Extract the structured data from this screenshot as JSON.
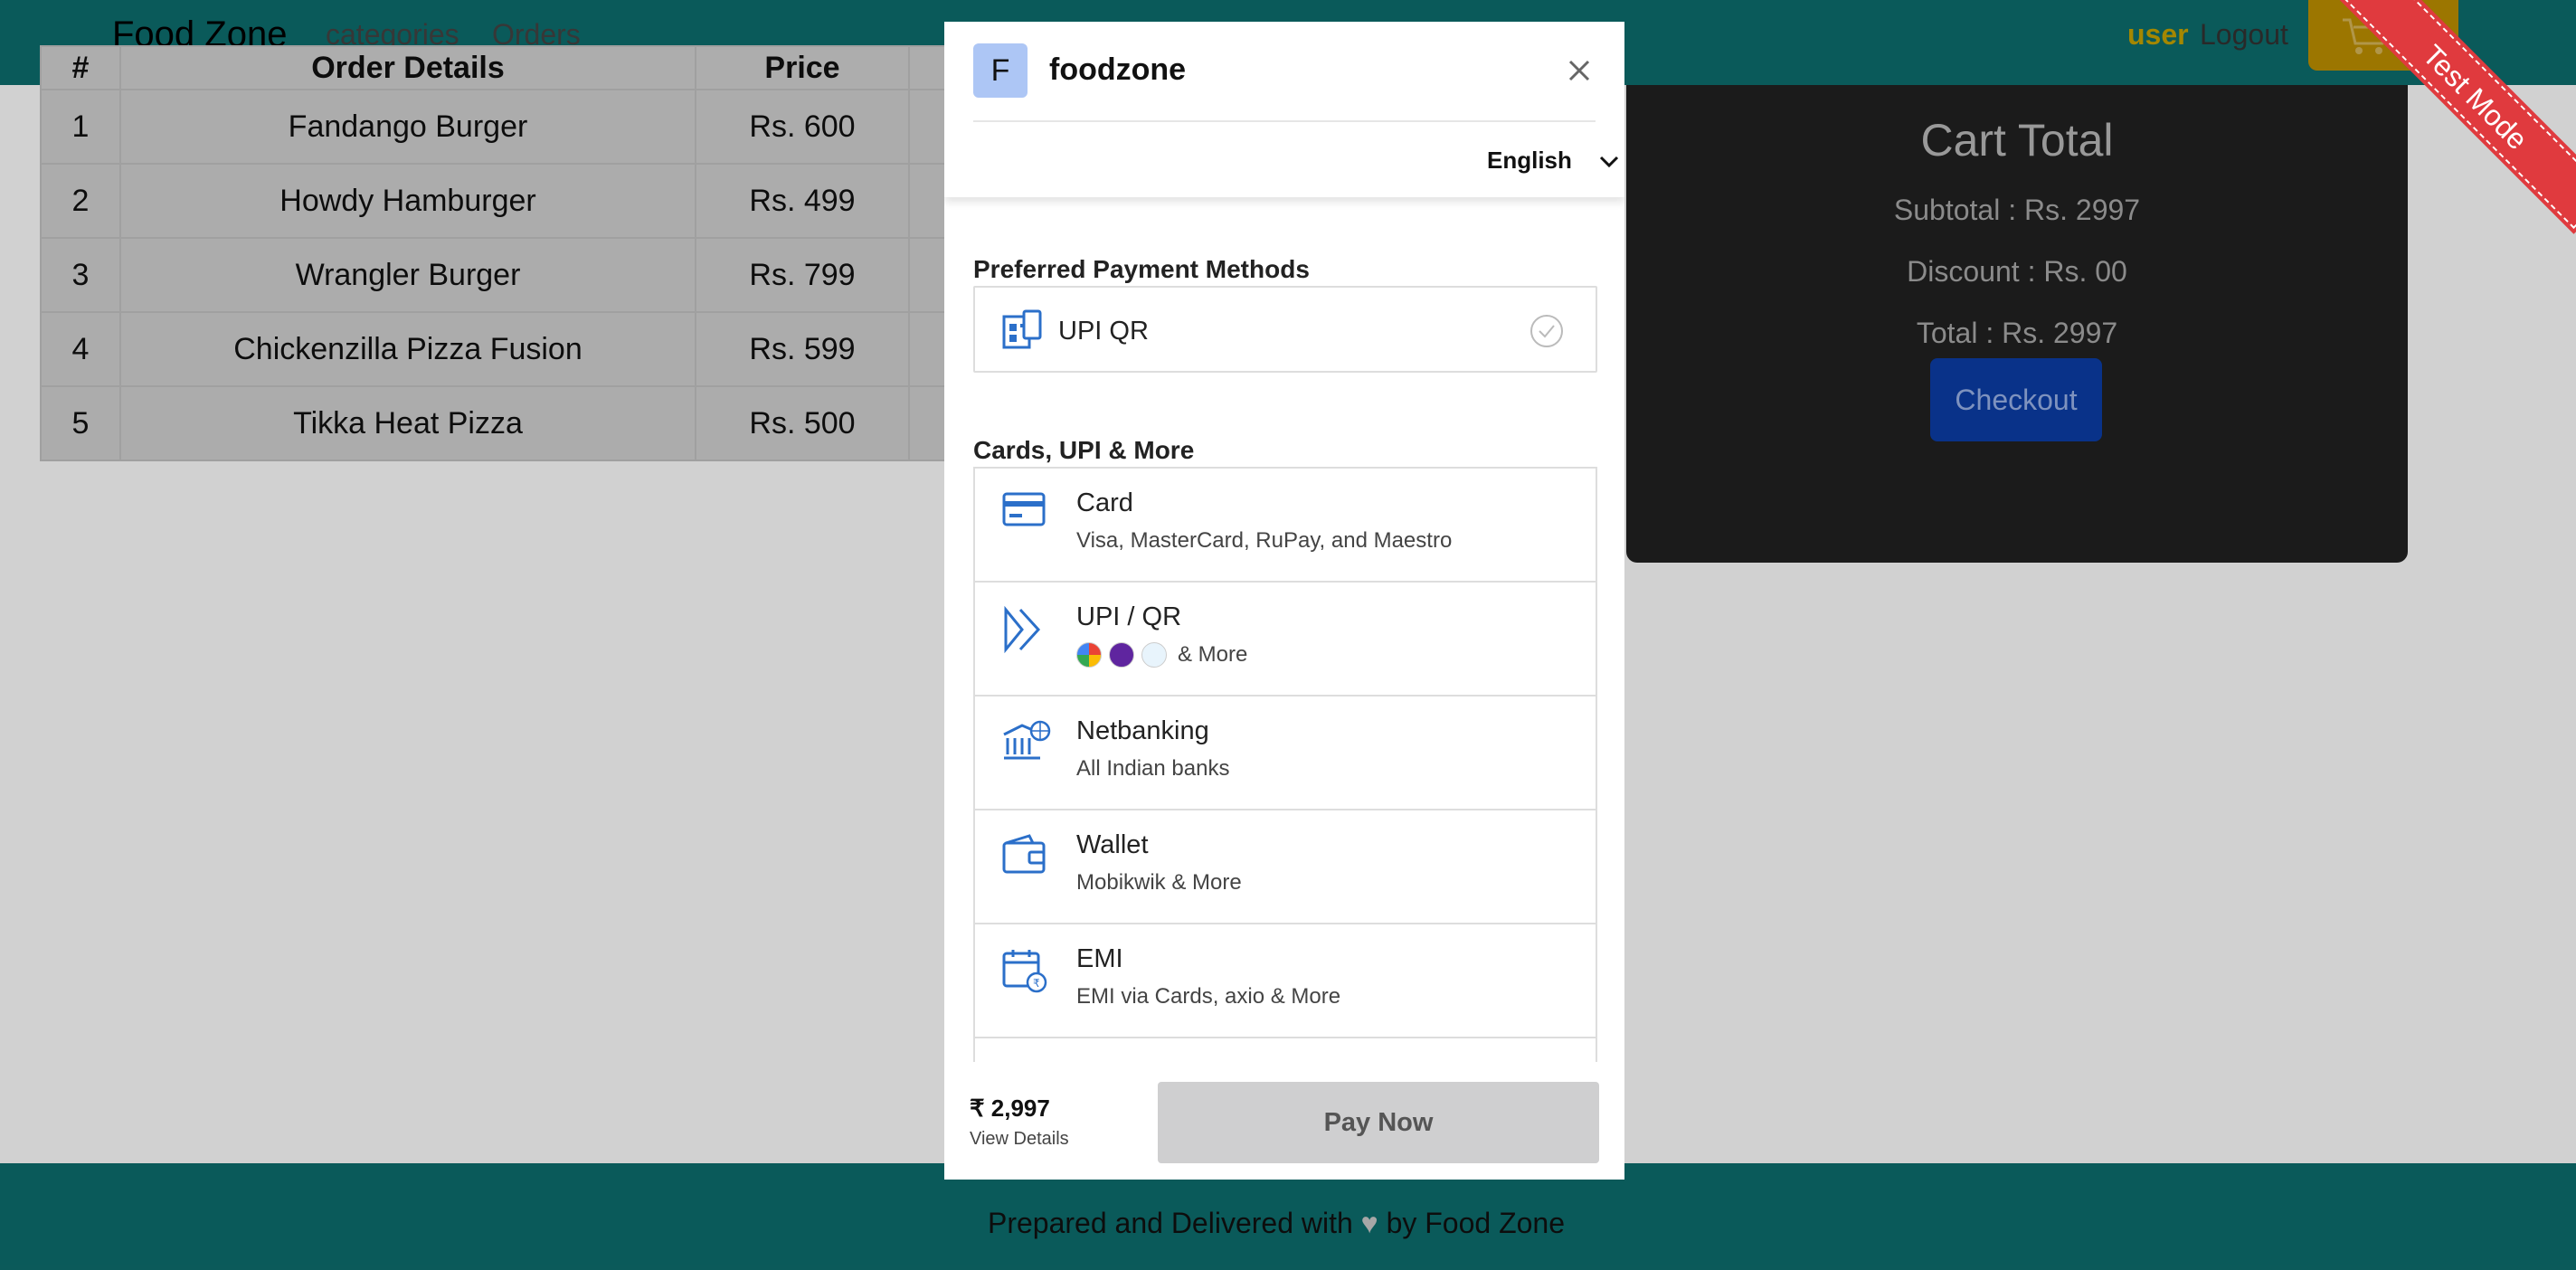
{
  "nav": {
    "brand": "Food Zone",
    "links": [
      "categories",
      "Orders"
    ],
    "user": "user",
    "logout": "Logout"
  },
  "ribbon": "Test Mode",
  "orders_table": {
    "headers": [
      "#",
      "Order Details",
      "Price",
      ""
    ],
    "rows": [
      {
        "num": "1",
        "item": "Fandango Burger",
        "price": "Rs. 600"
      },
      {
        "num": "2",
        "item": "Howdy Hamburger",
        "price": "Rs. 499"
      },
      {
        "num": "3",
        "item": "Wrangler Burger",
        "price": "Rs. 799"
      },
      {
        "num": "4",
        "item": "Chickenzilla Pizza Fusion",
        "price": "Rs. 599"
      },
      {
        "num": "5",
        "item": "Tikka Heat Pizza",
        "price": "Rs. 500"
      }
    ]
  },
  "cart": {
    "title": "Cart Total",
    "subtotal": "Subtotal : Rs. 2997",
    "discount": "Discount : Rs. 00",
    "total": "Total : Rs. 2997",
    "checkout": "Checkout"
  },
  "footer": {
    "pre": "Prepared and Delivered with",
    "post": "by Food Zone"
  },
  "payment_modal": {
    "logo_letter": "F",
    "merchant": "foodzone",
    "language": "English",
    "preferred_title": "Preferred Payment Methods",
    "preferred": {
      "label": "UPI QR"
    },
    "more_title": "Cards, UPI & More",
    "methods": [
      {
        "title": "Card",
        "sub": "Visa, MasterCard, RuPay, and Maestro",
        "icon": "card-icon"
      },
      {
        "title": "UPI / QR",
        "sub": "& More",
        "icon": "upi-icon"
      },
      {
        "title": "Netbanking",
        "sub": "All Indian banks",
        "icon": "bank-icon"
      },
      {
        "title": "Wallet",
        "sub": "Mobikwik & More",
        "icon": "wallet-icon"
      },
      {
        "title": "EMI",
        "sub": "EMI via Cards, axio & More",
        "icon": "emi-icon"
      }
    ],
    "amount": "₹ 2,997",
    "view_details": "View Details",
    "pay_now": "Pay Now"
  },
  "colors": {
    "navbar": "#0d6e6e",
    "accent_blue": "#2b6fc9",
    "checkout": "#0b3ea8",
    "ribbon": "#e03a3e"
  }
}
